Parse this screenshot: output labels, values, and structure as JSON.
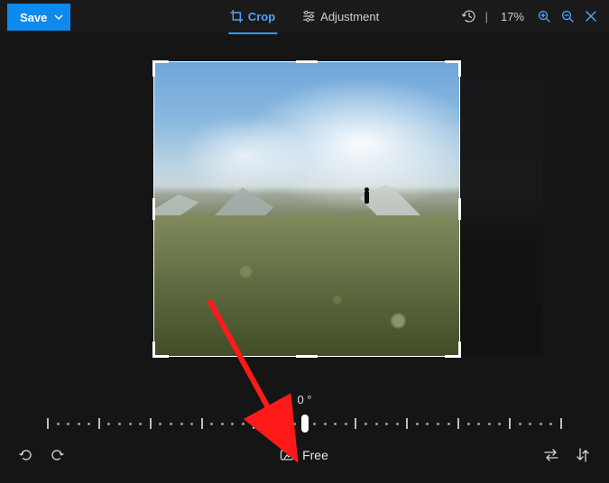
{
  "toolbar": {
    "save_label": "Save",
    "zoom_divider": "|"
  },
  "tabs": {
    "crop_label": "Crop",
    "adjustment_label": "Adjustment"
  },
  "zoom": {
    "level": "17%"
  },
  "rotation": {
    "angle_label": "0 °"
  },
  "aspect": {
    "mode_label": "Free"
  }
}
